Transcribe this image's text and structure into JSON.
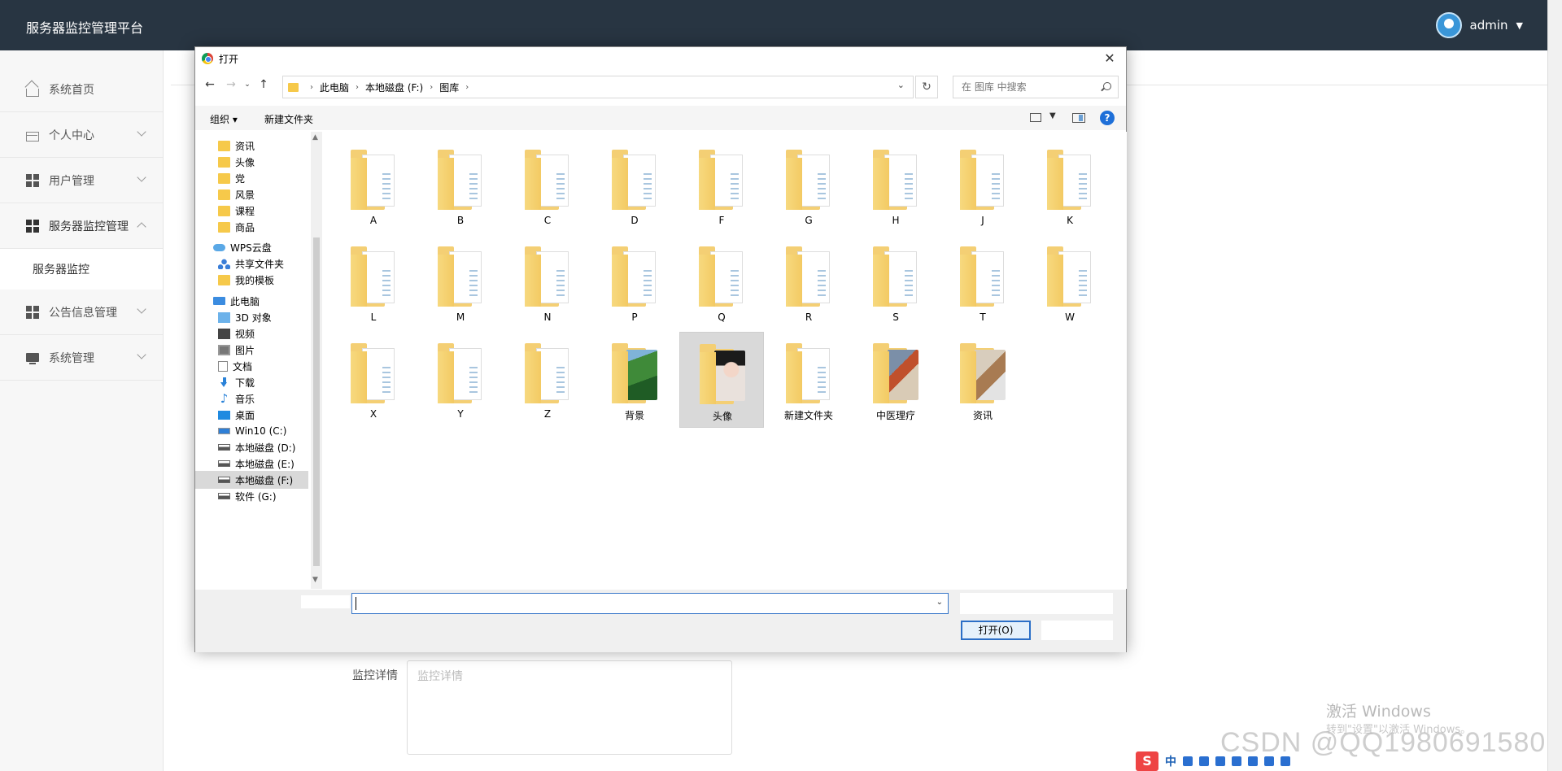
{
  "app": {
    "title": "服务器监控管理平台",
    "username": "admin"
  },
  "sidebar": {
    "items": [
      {
        "label": "系统首页",
        "icon": "home-icon"
      },
      {
        "label": "个人中心",
        "icon": "card-icon"
      },
      {
        "label": "用户管理",
        "icon": "grid-icon"
      },
      {
        "label": "服务器监控管理",
        "icon": "grid-icon",
        "expanded": true
      },
      {
        "label": "服务器监控",
        "sub": true
      },
      {
        "label": "公告信息管理",
        "icon": "grid-icon"
      },
      {
        "label": "系统管理",
        "icon": "monitor-icon"
      }
    ]
  },
  "form": {
    "monitor_label": "监控详情",
    "monitor_placeholder": "监控详情"
  },
  "dialog": {
    "title": "打开",
    "breadcrumb": [
      "此电脑",
      "本地磁盘 (F:)",
      "图库"
    ],
    "search_placeholder": "在 图库 中搜索",
    "commands": {
      "organize": "组织 ▾",
      "new_folder": "新建文件夹"
    },
    "nav_tree": [
      {
        "label": "资讯",
        "icon": "folder",
        "pinned": true
      },
      {
        "label": "头像",
        "icon": "folder",
        "pinned": true
      },
      {
        "label": "党",
        "icon": "folder"
      },
      {
        "label": "风景",
        "icon": "folder"
      },
      {
        "label": "课程",
        "icon": "folder"
      },
      {
        "label": "商品",
        "icon": "folder"
      },
      {
        "label": "WPS云盘",
        "icon": "cloud"
      },
      {
        "label": "共享文件夹",
        "icon": "share"
      },
      {
        "label": "我的模板",
        "icon": "folder"
      },
      {
        "label": "此电脑",
        "icon": "pc"
      },
      {
        "label": "3D 对象",
        "icon": "3d"
      },
      {
        "label": "视频",
        "icon": "video"
      },
      {
        "label": "图片",
        "icon": "pic"
      },
      {
        "label": "文档",
        "icon": "doc"
      },
      {
        "label": "下载",
        "icon": "down"
      },
      {
        "label": "音乐",
        "icon": "music"
      },
      {
        "label": "桌面",
        "icon": "desk"
      },
      {
        "label": "Win10 (C:)",
        "icon": "win"
      },
      {
        "label": "本地磁盘 (D:)",
        "icon": "drive"
      },
      {
        "label": "本地磁盘 (E:)",
        "icon": "drive"
      },
      {
        "label": "本地磁盘 (F:)",
        "icon": "drive",
        "selected": true
      },
      {
        "label": "软件 (G:)",
        "icon": "drive"
      }
    ],
    "files": [
      {
        "name": "A"
      },
      {
        "name": "B"
      },
      {
        "name": "C"
      },
      {
        "name": "D"
      },
      {
        "name": "F"
      },
      {
        "name": "G"
      },
      {
        "name": "H"
      },
      {
        "name": "J"
      },
      {
        "name": "K"
      },
      {
        "name": "L"
      },
      {
        "name": "M"
      },
      {
        "name": "N"
      },
      {
        "name": "P"
      },
      {
        "name": "Q"
      },
      {
        "name": "R"
      },
      {
        "name": "S"
      },
      {
        "name": "T"
      },
      {
        "name": "W"
      },
      {
        "name": "X"
      },
      {
        "name": "Y"
      },
      {
        "name": "Z"
      },
      {
        "name": "背景",
        "thumb": "landscape"
      },
      {
        "name": "头像",
        "thumb": "portrait",
        "selected": true
      },
      {
        "name": "新建文件夹"
      },
      {
        "name": "中医理疗",
        "thumb": "tcm"
      },
      {
        "name": "资讯",
        "thumb": "news"
      }
    ],
    "filename_value": "",
    "open_button": "打开(O)"
  },
  "watermark": {
    "activate_title": "激活 Windows",
    "activate_sub": "转到\"设置\"以激活 Windows。",
    "csdn": "CSDN @QQ1980691580"
  },
  "ime": {
    "logo": "S",
    "mode": "中"
  }
}
